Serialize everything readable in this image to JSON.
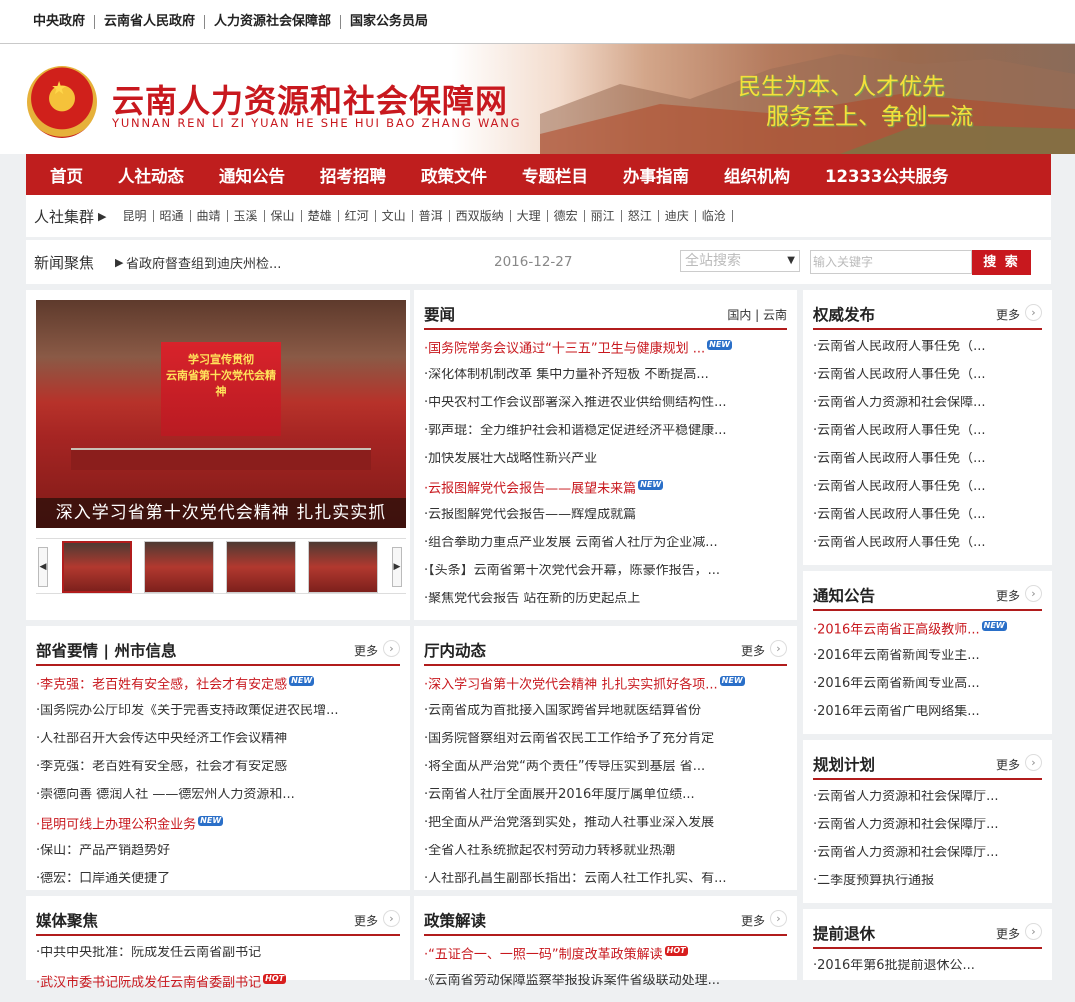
{
  "top_links": [
    "中央政府",
    "云南省人民政府",
    "人力资源社会保障部",
    "国家公务员局"
  ],
  "header": {
    "title": "云南人力资源和社会保障网",
    "subtitle": "YUNNAN REN LI ZI YUAN HE SHE HUI BAO ZHANG WANG",
    "slogan1": "民生为本、人才优先",
    "slogan2": "服务至上、争创一流"
  },
  "nav": [
    "首页",
    "人社动态",
    "通知公告",
    "招考招聘",
    "政策文件",
    "专题栏目",
    "办事指南",
    "组织机构",
    "12333公共服务"
  ],
  "cities": {
    "label": "人社集群",
    "items": [
      "昆明",
      "昭通",
      "曲靖",
      "玉溪",
      "保山",
      "楚雄",
      "红河",
      "文山",
      "普洱",
      "西双版纳",
      "大理",
      "德宏",
      "丽江",
      "怒江",
      "迪庆",
      "临沧"
    ]
  },
  "news_focus": {
    "label": "新闻聚焦",
    "text": "省政府督查组到迪庆州检...",
    "date": "2016-12-27",
    "search_select": "全站搜索",
    "search_placeholder": "输入关键字",
    "search_button": "搜 索"
  },
  "slideshow": {
    "caption": "深入学习省第十次党代会精神 扎扎实实抓",
    "screen_text": "学习宣传贯彻\n云南省第十次党代会精神"
  },
  "yaowen": {
    "title": "要闻",
    "tabs": "国内 | 云南",
    "items": [
      {
        "text": "国务院常务会议通过“十三五”卫生与健康规划 ...",
        "red": true,
        "tag": "NEW"
      },
      {
        "text": "深化体制机制改革 集中力量补齐短板 不断提高..."
      },
      {
        "text": "中央农村工作会议部署深入推进农业供给侧结构性..."
      },
      {
        "text": "郭声琨：全力维护社会和谐稳定促进经济平稳健康..."
      },
      {
        "text": "加快发展壮大战略性新兴产业"
      },
      {
        "text": "云报图解党代会报告——展望未来篇",
        "red": true,
        "tag": "NEW"
      },
      {
        "text": "云报图解党代会报告——辉煌成就篇"
      },
      {
        "text": "组合拳助力重点产业发展 云南省人社厅为企业减..."
      },
      {
        "text": "【头条】云南省第十次党代会开幕，陈豪作报告，..."
      },
      {
        "text": "聚焦党代会报告 站在新的历史起点上"
      }
    ]
  },
  "quanwei": {
    "title": "权威发布",
    "more": "更多",
    "items": [
      {
        "text": "云南省人民政府人事任免（..."
      },
      {
        "text": "云南省人民政府人事任免（..."
      },
      {
        "text": "云南省人力资源和社会保障..."
      },
      {
        "text": "云南省人民政府人事任免（..."
      },
      {
        "text": "云南省人民政府人事任免（..."
      },
      {
        "text": "云南省人民政府人事任免（..."
      },
      {
        "text": "云南省人民政府人事任免（..."
      },
      {
        "text": "云南省人民政府人事任免（..."
      }
    ]
  },
  "tongzhi": {
    "title": "通知公告",
    "more": "更多",
    "items": [
      {
        "text": "2016年云南省正高级教师...",
        "red": true,
        "tag": "NEW"
      },
      {
        "text": "2016年云南省新闻专业主..."
      },
      {
        "text": "2016年云南省新闻专业高..."
      },
      {
        "text": "2016年云南省广电网络集..."
      }
    ]
  },
  "guihua": {
    "title": "规划计划",
    "more": "更多",
    "items": [
      {
        "text": "云南省人力资源和社会保障厅..."
      },
      {
        "text": "云南省人力资源和社会保障厅..."
      },
      {
        "text": "云南省人力资源和社会保障厅..."
      },
      {
        "text": "二季度预算执行通报"
      }
    ]
  },
  "tiqian": {
    "title": "提前退休",
    "more": "更多",
    "items": [
      {
        "text": "2016年第6批提前退休公..."
      }
    ]
  },
  "busheng": {
    "title": "部省要情 | 州市信息",
    "more": "更多",
    "items": [
      {
        "text": "李克强：老百姓有安全感，社会才有安定感",
        "red": true,
        "tag": "NEW"
      },
      {
        "text": "国务院办公厅印发《关于完善支持政策促进农民增..."
      },
      {
        "text": "人社部召开大会传达中央经济工作会议精神"
      },
      {
        "text": "李克强：老百姓有安全感，社会才有安定感"
      },
      {
        "text": "崇德向善 德润人社 ——德宏州人力资源和..."
      },
      {
        "text": "昆明可线上办理公积金业务",
        "red": true,
        "tag": "NEW"
      },
      {
        "text": "保山：产品产销趋势好"
      },
      {
        "text": "德宏：口岸通关便捷了"
      }
    ]
  },
  "tingnei": {
    "title": "厅内动态",
    "more": "更多",
    "items": [
      {
        "text": "深入学习省第十次党代会精神 扎扎实实抓好各项...",
        "red": true,
        "tag": "NEW"
      },
      {
        "text": "云南省成为首批接入国家跨省异地就医结算省份"
      },
      {
        "text": "国务院督察组对云南省农民工工作给予了充分肯定"
      },
      {
        "text": "将全面从严治党“两个责任”传导压实到基层 省..."
      },
      {
        "text": "云南省人社厅全面展开2016年度厅属单位绩..."
      },
      {
        "text": "把全面从严治党落到实处，推动人社事业深入发展"
      },
      {
        "text": "全省人社系统掀起农村劳动力转移就业热潮"
      },
      {
        "text": "人社部孔昌生副部长指出：云南人社工作扎实、有..."
      }
    ]
  },
  "meiti": {
    "title": "媒体聚焦",
    "more": "更多",
    "items": [
      {
        "text": "中共中央批准：阮成发任云南省副书记"
      },
      {
        "text": "武汉市委书记阮成发任云南省委副书记",
        "red": true,
        "tag": "HOT"
      }
    ]
  },
  "zhengce": {
    "title": "政策解读",
    "more": "更多",
    "items": [
      {
        "text": "“五证合一、一照一码”制度改革政策解读",
        "red": true,
        "tag": "HOT"
      },
      {
        "text": "《云南省劳动保障监察举报投诉案件省级联动处理..."
      }
    ]
  }
}
